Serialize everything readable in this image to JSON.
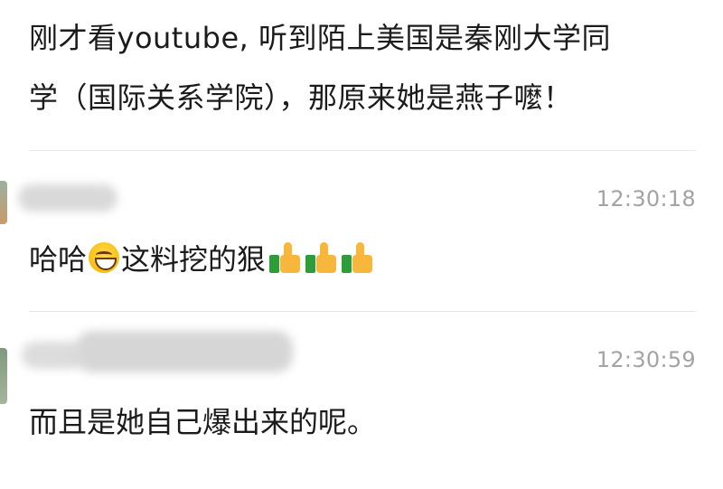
{
  "post": {
    "line1": "刚才看youtube, 听到陌上美国是秦刚大学同",
    "line2": "学（国际关系学院），那原来她是燕子嚒！"
  },
  "comments": [
    {
      "time": "12:30:18",
      "text_before": "哈哈",
      "emoji": "grinning-face-icon",
      "text_after": "这料挖的狠",
      "reactions": [
        "thumbs-up-icon",
        "thumbs-up-icon",
        "thumbs-up-icon"
      ]
    },
    {
      "time": "12:30:59",
      "text": "而且是她自己爆出来的呢。"
    }
  ],
  "colors": {
    "text": "#1b1b1b",
    "time": "#a3a3a3",
    "divider": "#e6e6e6"
  }
}
